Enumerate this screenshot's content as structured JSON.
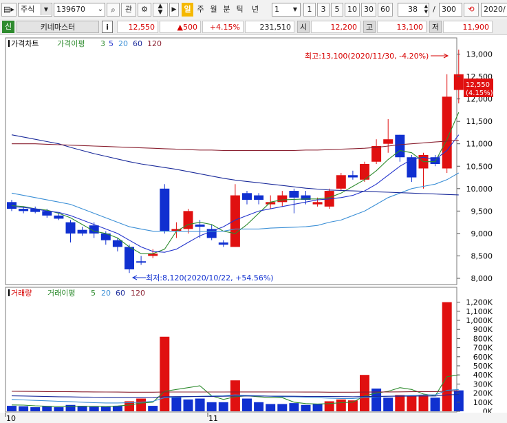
{
  "toolbar": {
    "market": "주식",
    "code": "139670",
    "watch_label": "관",
    "periods": [
      "일",
      "주",
      "월",
      "분",
      "틱",
      "년"
    ],
    "period_count": "1",
    "quick": [
      "1",
      "3",
      "5",
      "10",
      "30",
      "60"
    ],
    "bars_visible": "38",
    "bars_total": "300",
    "date": "2020/"
  },
  "stock": {
    "badge": "신",
    "name": "키네마스터",
    "info_label": "i",
    "price": "12,550",
    "change": "▲500",
    "rate": "+4.15%",
    "volume": "231,510",
    "open_label": "시",
    "open": "12,200",
    "high_label": "고",
    "high": "13,100",
    "low_label": "저",
    "low": "11,900"
  },
  "price_legend": {
    "title": "가격차트",
    "ma_title": "가격이평",
    "periods": [
      "3",
      "5",
      "20",
      "60",
      "120"
    ]
  },
  "volume_legend": {
    "title": "거래량",
    "ma_title": "거래이평",
    "periods": [
      "5",
      "20",
      "60",
      "120"
    ]
  },
  "annotations": {
    "high": "최고:13,100(2020/11/30, -4.20%)",
    "low": "최저:8,120(2020/10/22, +54.56%)"
  },
  "current_price": {
    "price": "12,550",
    "rate": "(4.15%)"
  },
  "x_axis": {
    "labels": [
      "10",
      "11"
    ]
  },
  "colors": {
    "up": "#e01010",
    "down": "#1030d0",
    "ma3": "#2e8b2e",
    "ma5": "#2233cc",
    "ma20": "#3b8fd6",
    "ma60": "#1a2a9a",
    "ma120": "#8a2030"
  },
  "chart_data": [
    {
      "type": "candlestick",
      "title": "가격차트",
      "ylim": [
        8000,
        13100
      ],
      "y_ticks": [
        "13,000",
        "12,500",
        "12,000",
        "11,500",
        "11,000",
        "10,500",
        "10,000",
        "9,500",
        "9,000",
        "8,500",
        "8,000"
      ],
      "x_labels": [
        "10",
        "11"
      ],
      "candles": [
        {
          "o": 9700,
          "c": 9550,
          "h": 9750,
          "l": 9500
        },
        {
          "o": 9550,
          "c": 9500,
          "h": 9600,
          "l": 9450
        },
        {
          "o": 9550,
          "c": 9480,
          "h": 9600,
          "l": 9450
        },
        {
          "o": 9500,
          "c": 9400,
          "h": 9550,
          "l": 9350
        },
        {
          "o": 9400,
          "c": 9330,
          "h": 9450,
          "l": 9300
        },
        {
          "o": 9250,
          "c": 9000,
          "h": 9300,
          "l": 8800
        },
        {
          "o": 9080,
          "c": 9000,
          "h": 9150,
          "l": 8950
        },
        {
          "o": 9180,
          "c": 9000,
          "h": 9250,
          "l": 8900
        },
        {
          "o": 9000,
          "c": 8850,
          "h": 9050,
          "l": 8750
        },
        {
          "o": 8850,
          "c": 8700,
          "h": 8900,
          "l": 8600
        },
        {
          "o": 8700,
          "c": 8200,
          "h": 8750,
          "l": 8120
        },
        {
          "o": 8380,
          "c": 8370,
          "h": 8500,
          "l": 8300
        },
        {
          "o": 8500,
          "c": 8550,
          "h": 8650,
          "l": 8450
        },
        {
          "o": 10000,
          "c": 9050,
          "h": 10100,
          "l": 9000
        },
        {
          "o": 9050,
          "c": 9100,
          "h": 9250,
          "l": 8900
        },
        {
          "o": 9100,
          "c": 9500,
          "h": 9550,
          "l": 9000
        },
        {
          "o": 9200,
          "c": 9150,
          "h": 9300,
          "l": 8900
        },
        {
          "o": 9100,
          "c": 8900,
          "h": 9200,
          "l": 8850
        },
        {
          "o": 8800,
          "c": 8750,
          "h": 8850,
          "l": 8700
        },
        {
          "o": 8700,
          "c": 9850,
          "h": 10100,
          "l": 8700
        },
        {
          "o": 9900,
          "c": 9750,
          "h": 9950,
          "l": 9650
        },
        {
          "o": 9850,
          "c": 9750,
          "h": 9900,
          "l": 9650
        },
        {
          "o": 9650,
          "c": 9700,
          "h": 9850,
          "l": 9550
        },
        {
          "o": 9700,
          "c": 9850,
          "h": 9950,
          "l": 9600
        },
        {
          "o": 9950,
          "c": 9800,
          "h": 10000,
          "l": 9450
        },
        {
          "o": 9850,
          "c": 9750,
          "h": 9950,
          "l": 9650
        },
        {
          "o": 9650,
          "c": 9700,
          "h": 9800,
          "l": 9600
        },
        {
          "o": 9600,
          "c": 9950,
          "h": 10000,
          "l": 9550
        },
        {
          "o": 10000,
          "c": 10300,
          "h": 10350,
          "l": 9950
        },
        {
          "o": 10300,
          "c": 10250,
          "h": 10400,
          "l": 10200
        },
        {
          "o": 10200,
          "c": 10550,
          "h": 10600,
          "l": 10150
        },
        {
          "o": 10600,
          "c": 10950,
          "h": 11100,
          "l": 10550
        },
        {
          "o": 11000,
          "c": 11100,
          "h": 11550,
          "l": 10800
        },
        {
          "o": 11200,
          "c": 10700,
          "h": 11200,
          "l": 10600
        },
        {
          "o": 10700,
          "c": 10250,
          "h": 10750,
          "l": 10150
        },
        {
          "o": 10450,
          "c": 10750,
          "h": 10800,
          "l": 10000
        },
        {
          "o": 10700,
          "c": 10550,
          "h": 10750,
          "l": 10500
        },
        {
          "o": 10450,
          "c": 12050,
          "h": 12550,
          "l": 10350
        },
        {
          "o": 12200,
          "c": 12550,
          "h": 13100,
          "l": 11900
        }
      ],
      "series": [
        {
          "name": "3",
          "values": [
            9620,
            9600,
            9550,
            9520,
            9450,
            9350,
            9200,
            9050,
            9000,
            8900,
            8700,
            8550,
            8550,
            8650,
            9050,
            9200,
            9250,
            9200,
            9050,
            9000,
            9200,
            9450,
            9700,
            9750,
            9760,
            9770,
            9770,
            9800,
            9900,
            10050,
            10200,
            10400,
            10650,
            10850,
            10800,
            10600,
            10600,
            11100,
            11700
          ]
        },
        {
          "name": "5",
          "values": [
            9600,
            9580,
            9550,
            9500,
            9470,
            9400,
            9300,
            9200,
            9100,
            9000,
            8850,
            8700,
            8600,
            8580,
            8650,
            8800,
            8950,
            9050,
            9150,
            9300,
            9400,
            9500,
            9550,
            9600,
            9650,
            9700,
            9750,
            9770,
            9800,
            9850,
            9950,
            10100,
            10300,
            10500,
            10650,
            10700,
            10650,
            10850,
            11200
          ]
        },
        {
          "name": "20",
          "values": [
            9900,
            9850,
            9800,
            9750,
            9700,
            9650,
            9550,
            9450,
            9350,
            9250,
            9150,
            9100,
            9050,
            9050,
            9050,
            9050,
            9050,
            9050,
            9050,
            9100,
            9100,
            9100,
            9120,
            9130,
            9140,
            9150,
            9180,
            9250,
            9300,
            9400,
            9500,
            9650,
            9800,
            9900,
            10000,
            10050,
            10100,
            10200,
            10350
          ]
        },
        {
          "name": "60",
          "values": [
            11200,
            11150,
            11100,
            11050,
            11000,
            10920,
            10850,
            10780,
            10720,
            10660,
            10600,
            10550,
            10510,
            10470,
            10430,
            10380,
            10330,
            10280,
            10230,
            10190,
            10160,
            10130,
            10100,
            10070,
            10040,
            10010,
            9990,
            9970,
            9960,
            9950,
            9940,
            9930,
            9920,
            9910,
            9900,
            9890,
            9880,
            9870,
            9860
          ]
        },
        {
          "name": "120",
          "values": [
            11000,
            11000,
            11000,
            10990,
            10980,
            10970,
            10960,
            10950,
            10940,
            10930,
            10920,
            10910,
            10900,
            10890,
            10880,
            10870,
            10860,
            10860,
            10850,
            10850,
            10850,
            10850,
            10850,
            10850,
            10850,
            10860,
            10860,
            10870,
            10880,
            10890,
            10900,
            10920,
            10950,
            10980,
            11000,
            11020,
            11040,
            11060,
            11080
          ]
        }
      ]
    },
    {
      "type": "bar",
      "title": "거래량",
      "ylim": [
        0,
        1250
      ],
      "y_ticks": [
        "1,200K",
        "1,100K",
        "1,000K",
        "900K",
        "800K",
        "700K",
        "600K",
        "500K",
        "400K",
        "300K",
        "200K",
        "100K",
        "0K"
      ],
      "values": [
        60,
        55,
        45,
        55,
        45,
        70,
        55,
        50,
        50,
        60,
        110,
        140,
        60,
        820,
        160,
        130,
        140,
        100,
        100,
        340,
        140,
        100,
        80,
        80,
        90,
        70,
        80,
        110,
        130,
        120,
        400,
        250,
        150,
        180,
        170,
        180,
        150,
        1200,
        230
      ],
      "directions": [
        "d",
        "d",
        "d",
        "d",
        "d",
        "d",
        "d",
        "d",
        "d",
        "d",
        "u",
        "u",
        "d",
        "u",
        "d",
        "d",
        "d",
        "d",
        "d",
        "u",
        "d",
        "d",
        "d",
        "d",
        "d",
        "d",
        "d",
        "u",
        "u",
        "u",
        "u",
        "d",
        "d",
        "u",
        "u",
        "u",
        "d",
        "u",
        "d"
      ],
      "series": [
        {
          "name": "5",
          "values": [
            70,
            68,
            60,
            55,
            52,
            55,
            56,
            55,
            52,
            58,
            70,
            90,
            100,
            220,
            240,
            260,
            280,
            170,
            130,
            160,
            170,
            160,
            150,
            150,
            100,
            85,
            80,
            85,
            95,
            100,
            170,
            200,
            220,
            260,
            240,
            190,
            170,
            380,
            400
          ]
        },
        {
          "name": "20",
          "values": [
            130,
            125,
            120,
            115,
            110,
            105,
            100,
            95,
            92,
            92,
            95,
            100,
            110,
            150,
            155,
            160,
            165,
            168,
            170,
            180,
            175,
            170,
            165,
            160,
            160,
            155,
            150,
            145,
            140,
            140,
            150,
            160,
            165,
            170,
            175,
            180,
            180,
            230,
            240
          ]
        },
        {
          "name": "60",
          "values": [
            170,
            168,
            165,
            162,
            160,
            158,
            156,
            155,
            154,
            153,
            152,
            152,
            153,
            160,
            161,
            162,
            163,
            164,
            165,
            168,
            168,
            168,
            167,
            166,
            165,
            164,
            163,
            162,
            161,
            160,
            162,
            164,
            165,
            166,
            167,
            168,
            168,
            180,
            185
          ]
        },
        {
          "name": "120",
          "values": [
            220,
            219,
            218,
            217,
            216,
            215,
            214,
            213,
            212,
            211,
            210,
            210,
            210,
            212,
            212,
            212,
            212,
            212,
            212,
            213,
            213,
            213,
            213,
            212,
            212,
            211,
            211,
            210,
            210,
            210,
            211,
            212,
            213,
            214,
            215,
            216,
            216,
            222,
            224
          ]
        }
      ]
    }
  ]
}
